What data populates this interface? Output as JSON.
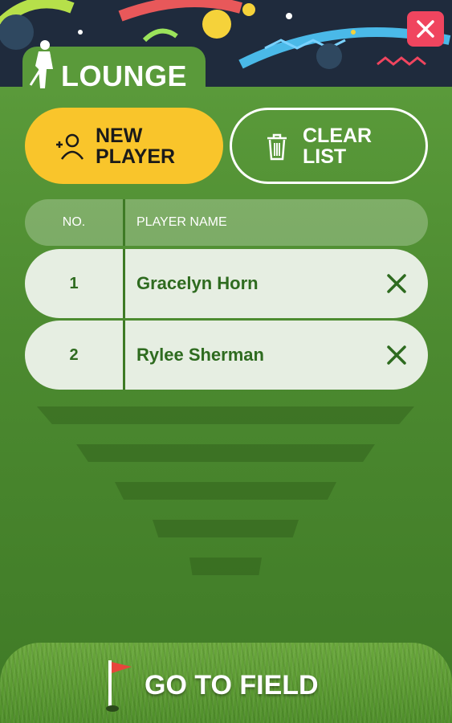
{
  "header": {
    "title": "LOUNGE"
  },
  "actions": {
    "new_player_label": "NEW\nPLAYER",
    "clear_list_label": "CLEAR\nLIST"
  },
  "table": {
    "columns": [
      "NO.",
      "PLAYER NAME"
    ],
    "rows": [
      {
        "no": "1",
        "name": "Gracelyn Horn"
      },
      {
        "no": "2",
        "name": "Rylee Sherman"
      }
    ]
  },
  "footer": {
    "go_label": "GO TO FIELD"
  },
  "colors": {
    "accent_yellow": "#f9c52b",
    "close_red": "#f0455f",
    "text_green": "#2e6b1f"
  },
  "icons": [
    "golfer-icon",
    "close-icon",
    "add-user-icon",
    "trash-icon",
    "remove-x-icon",
    "flag-icon"
  ]
}
